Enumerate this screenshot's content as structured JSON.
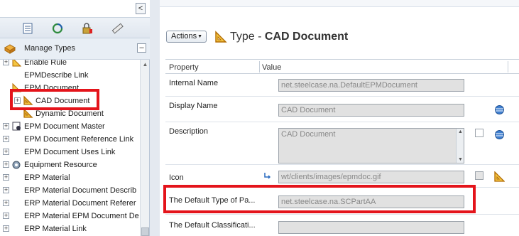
{
  "left_panel": {
    "collapse_glyph": "<",
    "toolbar_icons": [
      "list-view-icon",
      "refresh-icon",
      "lock-icon",
      "ruler-icon"
    ],
    "manage_types": {
      "title": "Manage Types",
      "collapse_glyph": "–"
    },
    "tree": [
      {
        "label": "Enable Rule",
        "expander": "+",
        "indent": 0,
        "icon": "rule-icon"
      },
      {
        "label": "EPMDescribe Link",
        "expander": "",
        "indent": 0,
        "icon": ""
      },
      {
        "label": "EPM Document",
        "expander": "",
        "indent": 0,
        "icon": "document-icon"
      },
      {
        "label": "CAD Document",
        "expander": "+",
        "indent": 1,
        "icon": "cad-document-icon"
      },
      {
        "label": "Dynamic Document",
        "expander": "",
        "indent": 1,
        "icon": "dynamic-document-icon"
      },
      {
        "label": "EPM Document Master",
        "expander": "+",
        "indent": 0,
        "icon": "document-master-icon"
      },
      {
        "label": "EPM Document Reference Link",
        "expander": "+",
        "indent": 0,
        "icon": ""
      },
      {
        "label": "EPM Document Uses Link",
        "expander": "+",
        "indent": 0,
        "icon": ""
      },
      {
        "label": "Equipment Resource",
        "expander": "+",
        "indent": 0,
        "icon": "equipment-icon"
      },
      {
        "label": "ERP Material",
        "expander": "+",
        "indent": 0,
        "icon": ""
      },
      {
        "label": "ERP Material Document Describ",
        "expander": "+",
        "indent": 0,
        "icon": ""
      },
      {
        "label": "ERP Material Document Referer",
        "expander": "+",
        "indent": 0,
        "icon": ""
      },
      {
        "label": "ERP Material EPM Document De",
        "expander": "+",
        "indent": 0,
        "icon": ""
      },
      {
        "label": "ERP Material Link",
        "expander": "+",
        "indent": 0,
        "icon": ""
      }
    ]
  },
  "right_panel": {
    "actions_label": "Actions",
    "type_prefix": "Type - ",
    "type_name": "CAD Document",
    "columns": {
      "property": "Property",
      "value": "Value"
    },
    "properties": [
      {
        "label": "Internal Name",
        "value": "net.steelcase.na.DefaultEPMDocument"
      },
      {
        "label": "Display Name",
        "value": "CAD Document"
      },
      {
        "label": "Description",
        "value": "CAD Document"
      },
      {
        "label": "Icon",
        "value": "wt/clients/images/epmdoc.gif"
      },
      {
        "label": "The Default Type of Pa...",
        "value": "net.steelcase.na.SCPartAA"
      },
      {
        "label": "The Default Classificati...",
        "value": ""
      }
    ]
  },
  "colors": {
    "highlight": "#e4141b",
    "panel_bg": "#f3f6fa",
    "field_bg": "#e1e1e1"
  }
}
